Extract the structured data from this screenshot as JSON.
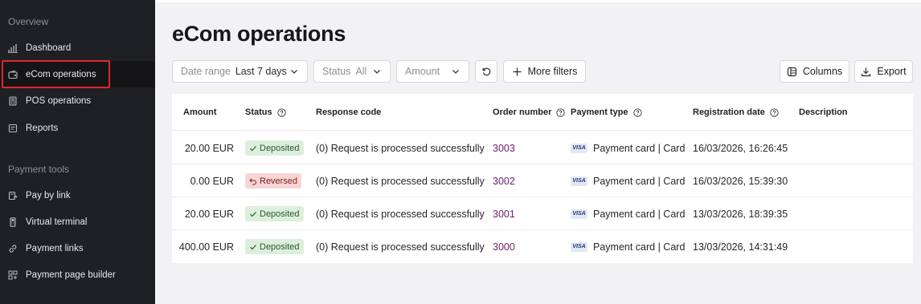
{
  "sidebar": {
    "overview_label": "Overview",
    "overview_items": [
      {
        "label": "Dashboard",
        "icon": "bar-chart-icon"
      },
      {
        "label": "eCom operations",
        "icon": "wallet-icon",
        "active": true
      },
      {
        "label": "POS operations",
        "icon": "pos-terminal-icon"
      },
      {
        "label": "Reports",
        "icon": "report-icon"
      }
    ],
    "payment_tools_label": "Payment tools",
    "payment_tools_items": [
      {
        "label": "Pay by link",
        "icon": "pay-link-icon"
      },
      {
        "label": "Virtual terminal",
        "icon": "terminal-icon"
      },
      {
        "label": "Payment links",
        "icon": "link-icon"
      },
      {
        "label": "Payment page builder",
        "icon": "page-builder-icon"
      }
    ],
    "active_highlight_color": "#e0262b"
  },
  "page": {
    "title": "eCom operations"
  },
  "filters": {
    "date_range": {
      "label": "Date range",
      "value": "Last 7 days"
    },
    "status": {
      "label": "Status",
      "value": "All"
    },
    "amount": {
      "placeholder": "Amount"
    },
    "more_filters_label": "More filters",
    "columns_label": "Columns",
    "export_label": "Export"
  },
  "table": {
    "headers": {
      "amount": "Amount",
      "status": "Status",
      "response_code": "Response code",
      "order_number": "Order number",
      "payment_type": "Payment type",
      "registration_date": "Registration date",
      "description": "Description"
    },
    "rows": [
      {
        "amount": "20.00 EUR",
        "status": "Deposited",
        "status_kind": "deposited",
        "response_code": "(0) Request is processed successfully",
        "order_number": "3003",
        "card_brand": "VISA",
        "payment_type": "Payment card | Card",
        "registration_date": "16/03/2026, 16:26:45",
        "description": ""
      },
      {
        "amount": "0.00 EUR",
        "status": "Reversed",
        "status_kind": "reversed",
        "response_code": "(0) Request is processed successfully",
        "order_number": "3002",
        "card_brand": "VISA",
        "payment_type": "Payment card | Card",
        "registration_date": "16/03/2026, 15:39:30",
        "description": ""
      },
      {
        "amount": "20.00 EUR",
        "status": "Deposited",
        "status_kind": "deposited",
        "response_code": "(0) Request is processed successfully",
        "order_number": "3001",
        "card_brand": "VISA",
        "payment_type": "Payment card | Card",
        "registration_date": "13/03/2026, 18:39:35",
        "description": ""
      },
      {
        "amount": "400.00 EUR",
        "status": "Deposited",
        "status_kind": "deposited",
        "response_code": "(0) Request is processed successfully",
        "order_number": "3000",
        "card_brand": "VISA",
        "payment_type": "Payment card | Card",
        "registration_date": "13/03/2026, 14:31:49",
        "description": ""
      }
    ],
    "colors": {
      "deposited_bg": "#dcefdc",
      "reversed_bg": "#f8d4d4",
      "order_link": "#6a1f6b"
    }
  }
}
